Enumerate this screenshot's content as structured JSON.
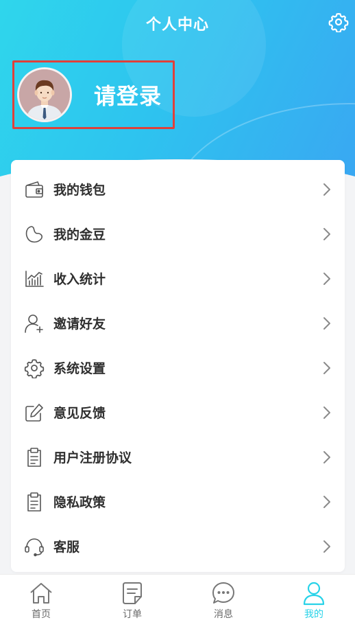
{
  "header": {
    "title": "个人中心",
    "settings_icon": "gear-icon"
  },
  "profile": {
    "login_label": "请登录",
    "avatar_icon": "default-avatar"
  },
  "menu": {
    "items": [
      {
        "label": "我的钱包",
        "icon": "wallet-icon"
      },
      {
        "label": "我的金豆",
        "icon": "bean-icon"
      },
      {
        "label": "收入统计",
        "icon": "chart-icon"
      },
      {
        "label": "邀请好友",
        "icon": "add-user-icon"
      },
      {
        "label": "系统设置",
        "icon": "gear-icon"
      },
      {
        "label": "意见反馈",
        "icon": "edit-icon"
      },
      {
        "label": "用户注册协议",
        "icon": "clipboard-icon"
      },
      {
        "label": "隐私政策",
        "icon": "clipboard-icon"
      },
      {
        "label": "客服",
        "icon": "headset-icon"
      }
    ]
  },
  "tabbar": {
    "tabs": [
      {
        "label": "首页",
        "icon": "home-icon"
      },
      {
        "label": "订单",
        "icon": "order-icon"
      },
      {
        "label": "消息",
        "icon": "message-icon"
      },
      {
        "label": "我的",
        "icon": "user-icon",
        "active": true
      }
    ]
  },
  "colors": {
    "accent": "#27d2e8",
    "header_start": "#2fd6ec",
    "header_end": "#3aa6f2",
    "highlight_border": "#e0403a"
  }
}
